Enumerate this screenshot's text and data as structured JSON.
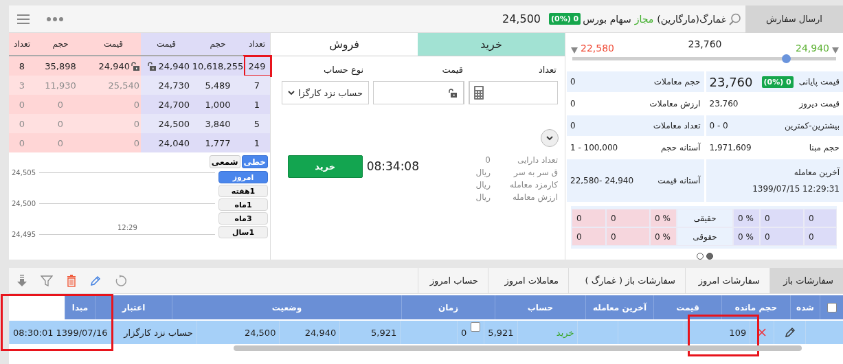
{
  "header": {
    "send_order": "ارسال سفارش",
    "symbol": "غمارگ(مارگارین)",
    "status": "مجاز",
    "market": "سهام بورس",
    "change_badge": "0 (0%)",
    "last_price": "24,500"
  },
  "price_range": {
    "high": "24,940",
    "mid": "23,760",
    "low": "22,580",
    "level": 0.81
  },
  "stats": [
    {
      "right": {
        "label": "قیمت پایانی",
        "value": "23,760",
        "badge": "0 (0%)",
        "kind": "big"
      },
      "left": {
        "label": "حجم معاملات",
        "value": "0"
      }
    },
    {
      "right": {
        "label": "قیمت دیروز",
        "value": "23,760"
      },
      "left": {
        "label": "ارزش معاملات",
        "value": "0"
      }
    },
    {
      "right": {
        "label": "بیشترین-کمترین",
        "value": "0 - 0"
      },
      "left": {
        "label": "تعداد معاملات",
        "value": "0"
      }
    },
    {
      "right": {
        "label": "حجم مبنا",
        "value": "1,971,609"
      },
      "left": {
        "label": "آستانه حجم",
        "value": "1 - 100,000"
      }
    },
    {
      "right": {
        "label": "آخرین معامله",
        "value": "1399/07/15 12:29:31",
        "kind": "stacked"
      },
      "left": {
        "label": "آستانه قیمت",
        "value": "22,580- 24,940"
      }
    }
  ],
  "traders": [
    {
      "label": "حقیقی",
      "buy": [
        "0",
        "0",
        "0 %"
      ],
      "sell": [
        "0 %",
        "0",
        "0"
      ]
    },
    {
      "label": "حقوقی",
      "buy": [
        "0",
        "0",
        "0 %"
      ],
      "sell": [
        "0 %",
        "0",
        "0"
      ]
    }
  ],
  "pager": [
    {
      "selected": true
    },
    {
      "selected": false
    }
  ],
  "order_form": {
    "tabs": [
      {
        "label": "خرید",
        "selected": true
      },
      {
        "label": "فروش",
        "selected": false
      }
    ],
    "count_label": "تعداد",
    "price_label": "قیمت",
    "account_label": "نوع حساب",
    "account_value": "حساب نزد کارگزا",
    "details": [
      {
        "label": "تعداد دارایی",
        "value": "0"
      },
      {
        "label": "ق سر به سر",
        "value": "ریال"
      },
      {
        "label": "کارمزد معامله",
        "value": "ریال"
      },
      {
        "label": "ارزش معامله",
        "value": "ریال"
      }
    ],
    "time": "08:34:08",
    "submit": "خرید"
  },
  "order_book": {
    "buy_columns": [
      "تعداد",
      "حجم",
      "قیمت"
    ],
    "sell_columns": [
      "قیمت",
      "حجم",
      "تعداد"
    ],
    "rows": [
      {
        "buy": {
          "count": "249",
          "volume": "10,618,255",
          "price": "24,940",
          "locked": true,
          "highlighted": true
        },
        "sell": {
          "price": "24,940",
          "volume": "35,898",
          "count": "8",
          "locked": true,
          "dim": false
        }
      },
      {
        "buy": {
          "count": "7",
          "volume": "5,489",
          "price": "24,730",
          "locked": false,
          "highlighted": false
        },
        "sell": {
          "price": "25,540",
          "volume": "11,930",
          "count": "3",
          "locked": false,
          "dim": true
        }
      },
      {
        "buy": {
          "count": "1",
          "volume": "1,000",
          "price": "24,700",
          "locked": false,
          "highlighted": false
        },
        "sell": {
          "price": "0",
          "volume": "0",
          "count": "0",
          "locked": false,
          "dim": true
        }
      },
      {
        "buy": {
          "count": "5",
          "volume": "3,840",
          "price": "24,500",
          "locked": false,
          "highlighted": false
        },
        "sell": {
          "price": "0",
          "volume": "0",
          "count": "0",
          "locked": false,
          "dim": true
        }
      },
      {
        "buy": {
          "count": "1",
          "volume": "1,777",
          "price": "24,040",
          "locked": false,
          "highlighted": false
        },
        "sell": {
          "price": "0",
          "volume": "0",
          "count": "0",
          "locked": false,
          "dim": true
        }
      }
    ]
  },
  "chart": {
    "y_labels": [
      "24,505",
      "24,500",
      "24,495"
    ],
    "x_label": "12:29",
    "types": [
      {
        "label": "خطی",
        "selected": true
      },
      {
        "label": "شمعی",
        "selected": false
      }
    ],
    "periods": [
      {
        "label": "امروز",
        "selected": true
      },
      {
        "label": "1هفته",
        "selected": false
      },
      {
        "label": "1ماه",
        "selected": false
      },
      {
        "label": "3ماه",
        "selected": false
      },
      {
        "label": "1سال",
        "selected": false
      }
    ]
  },
  "orders": {
    "tabs": [
      {
        "label": "سفارشات باز",
        "selected": true
      },
      {
        "label": "سفارشات امروز",
        "selected": false
      },
      {
        "label": "سفارشات باز ( غمارگ )",
        "selected": false
      },
      {
        "label": "معاملات امروز",
        "selected": false
      },
      {
        "label": "حساب امروز",
        "selected": false
      }
    ],
    "header_row": {
      "cells": [
        {
          "kind": "checkbox",
          "checked": false
        },
        {
          "label": "شده"
        },
        {
          "label": "حجم مانده"
        },
        {
          "label": "قیمت"
        },
        {
          "label": "آخرین معامله"
        },
        {
          "label": "حساب"
        },
        {
          "label": "زمان"
        },
        {
          "label": "وضعیت"
        },
        {
          "label": "اعتبار"
        },
        {
          "label": "مبدا"
        },
        {
          "kind": "blank"
        }
      ]
    },
    "rows": [
      {
        "selected": true,
        "cells": [
          {
            "kind": "blank"
          },
          {
            "kind": "edit"
          },
          {
            "kind": "cancel"
          },
          {
            "text": "109",
            "highlighted": true
          },
          {
            "kind": "blank"
          },
          {
            "kind": "blank"
          },
          {
            "kind": "side",
            "text": "خرید"
          },
          {
            "text": "5,921"
          },
          {
            "kind": "check",
            "text": "0",
            "checked": false
          },
          {
            "kind": "blank"
          },
          {
            "text": "5,921"
          },
          {
            "text": "24,940"
          },
          {
            "text": "24,500"
          },
          {
            "text": "حساب نزد کارگزار"
          },
          {
            "text": "1399/07/16 08:30:01",
            "highlighted": true
          }
        ]
      }
    ]
  }
}
